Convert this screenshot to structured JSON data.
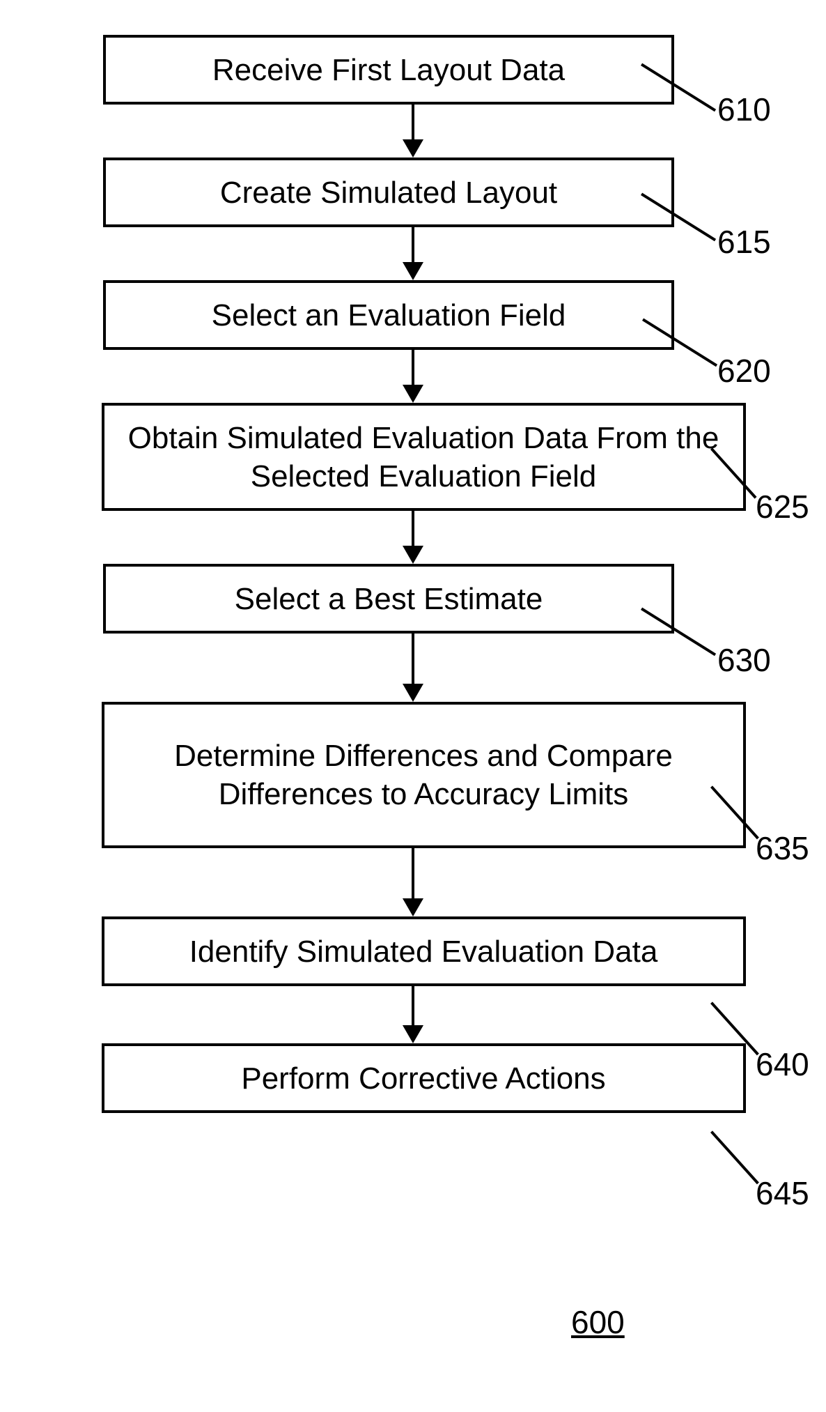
{
  "flowchart": {
    "steps": [
      {
        "text": "Receive First Layout Data",
        "ref": "610"
      },
      {
        "text": "Create Simulated Layout",
        "ref": "615"
      },
      {
        "text": "Select an Evaluation Field",
        "ref": "620"
      },
      {
        "text": "Obtain Simulated Evaluation Data From the Selected Evaluation Field",
        "ref": "625"
      },
      {
        "text": "Select a Best Estimate",
        "ref": "630"
      },
      {
        "text": "Determine Differences and Compare Differences to Accuracy Limits",
        "ref": "635"
      },
      {
        "text": "Identify Simulated Evaluation Data",
        "ref": "640"
      },
      {
        "text": "Perform Corrective Actions",
        "ref": "645"
      }
    ],
    "figure_number": "600"
  }
}
